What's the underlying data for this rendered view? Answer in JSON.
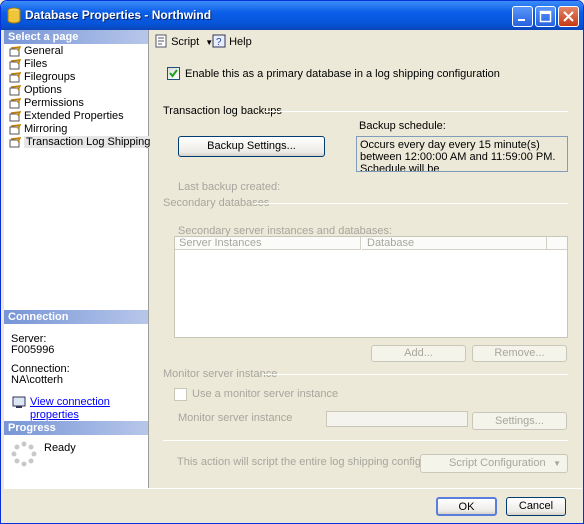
{
  "window": {
    "title": "Database Properties - Northwind"
  },
  "left": {
    "select_header": "Select a page",
    "pages": [
      "General",
      "Files",
      "Filegroups",
      "Options",
      "Permissions",
      "Extended Properties",
      "Mirroring",
      "Transaction Log Shipping"
    ],
    "connection_header": "Connection",
    "server_label": "Server:",
    "server_value": "F005996",
    "connection_label": "Connection:",
    "connection_value": "NA\\cotterh",
    "view_link": "View connection properties",
    "progress_header": "Progress",
    "progress_status": "Ready"
  },
  "toolbar": {
    "script": "Script",
    "help": "Help"
  },
  "main": {
    "enable_primary": "Enable this as a primary database in a log shipping configuration",
    "tlog_section": "Transaction log backups",
    "backup_schedule_label": "Backup schedule:",
    "backup_settings_button": "Backup Settings...",
    "schedule_text": "Occurs every day every 15 minute(s) between 12:00:00 AM and 11:59:00 PM. Schedule will be",
    "last_backup_label": "Last backup created:",
    "secondary_section": "Secondary databases",
    "secondary_instances_label": "Secondary server instances and databases:",
    "grid_columns": [
      "Server Instances",
      "Database"
    ],
    "add_button": "Add...",
    "remove_button": "Remove...",
    "monitor_section": "Monitor server instance",
    "use_monitor": "Use a monitor server instance",
    "monitor_instance_label": "Monitor server instance",
    "settings_button": "Settings...",
    "script_note": "This action will script the entire log shipping configuration.",
    "script_config_button": "Script Configuration"
  },
  "footer": {
    "ok": "OK",
    "cancel": "Cancel"
  }
}
